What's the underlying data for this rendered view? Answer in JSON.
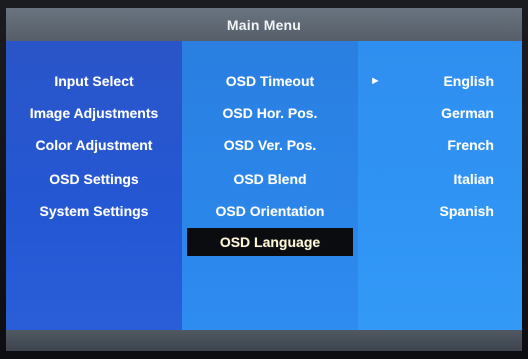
{
  "menu": {
    "title": "Main Menu"
  },
  "main_items": [
    {
      "label": "Input Select"
    },
    {
      "label": "Image Adjustments"
    },
    {
      "label": "Color Adjustment"
    },
    {
      "label": "OSD Settings"
    },
    {
      "label": "System Settings"
    }
  ],
  "osd_items": [
    {
      "label": "OSD Timeout"
    },
    {
      "label": "OSD Hor. Pos."
    },
    {
      "label": "OSD Ver. Pos."
    },
    {
      "label": "OSD Blend"
    },
    {
      "label": "OSD Orientation"
    },
    {
      "label": "OSD Language",
      "selected": true
    }
  ],
  "languages": [
    {
      "label": "English",
      "current": true
    },
    {
      "label": "German"
    },
    {
      "label": "French"
    },
    {
      "label": "Italian"
    },
    {
      "label": "Spanish"
    }
  ],
  "cursor_glyph": "►",
  "colors": {
    "title_bar": "#5f6873",
    "column_1": "#2457d4",
    "column_2": "#2b86ea",
    "column_3": "#2f94f4",
    "selected_bg": "#0b0c10"
  }
}
